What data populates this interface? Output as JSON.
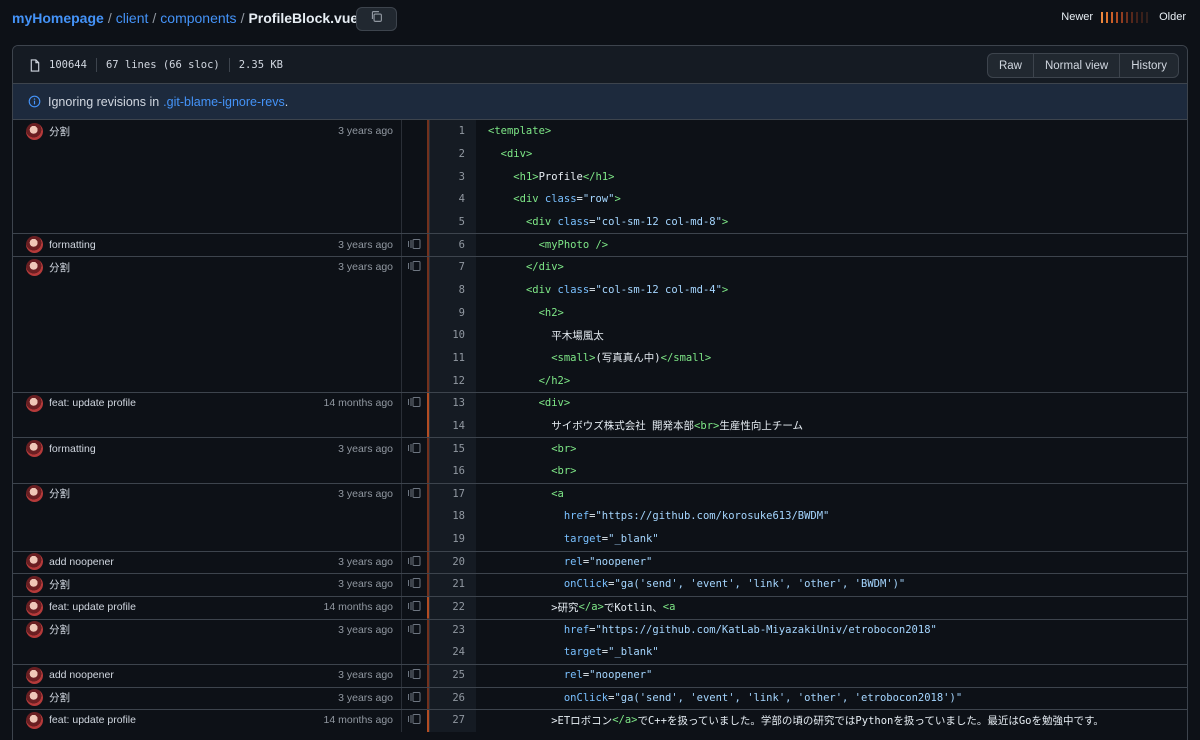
{
  "breadcrumb": {
    "repo": "myHomepage",
    "parts": [
      "client",
      "components"
    ],
    "file": "ProfileBlock.vue",
    "separator": "/"
  },
  "legend": {
    "newer": "Newer",
    "older": "Older",
    "colors": [
      "#f0883e",
      "#e0742f",
      "#cc5f28",
      "#b34d23",
      "#913d20",
      "#72311d",
      "#57281b",
      "#45221a",
      "#3a201a",
      "#32201c"
    ]
  },
  "fileinfo": {
    "mode": "100644",
    "lines": "67 lines (66 sloc)",
    "size": "2.35 KB"
  },
  "view_buttons": {
    "raw": "Raw",
    "normal": "Normal view",
    "history": "History"
  },
  "flash": {
    "text": "Ignoring revisions in",
    "link": ".git-blame-ignore-revs",
    "suffix": "."
  },
  "colors": {
    "link": "#4493f8",
    "tag": "#7ee787",
    "attr": "#79c0ff",
    "string": "#a5d6ff"
  },
  "blocks": [
    {
      "msg": "分割",
      "age": "3 years ago",
      "start": 1,
      "count": 5,
      "reblame": false,
      "heat": "#72311d"
    },
    {
      "msg": "formatting",
      "age": "3 years ago",
      "start": 6,
      "count": 1,
      "reblame": true,
      "heat": "#72311d"
    },
    {
      "msg": "分割",
      "age": "3 years ago",
      "start": 7,
      "count": 6,
      "reblame": true,
      "heat": "#72311d"
    },
    {
      "msg": "feat: update profile",
      "age": "14 months ago",
      "start": 13,
      "count": 2,
      "reblame": true,
      "heat": "#b34d23"
    },
    {
      "msg": "formatting",
      "age": "3 years ago",
      "start": 15,
      "count": 2,
      "reblame": true,
      "heat": "#72311d"
    },
    {
      "msg": "分割",
      "age": "3 years ago",
      "start": 17,
      "count": 3,
      "reblame": true,
      "heat": "#72311d"
    },
    {
      "msg": "add noopener",
      "age": "3 years ago",
      "start": 20,
      "count": 1,
      "reblame": true,
      "heat": "#72311d"
    },
    {
      "msg": "分割",
      "age": "3 years ago",
      "start": 21,
      "count": 1,
      "reblame": true,
      "heat": "#72311d"
    },
    {
      "msg": "feat: update profile",
      "age": "14 months ago",
      "start": 22,
      "count": 1,
      "reblame": true,
      "heat": "#b34d23"
    },
    {
      "msg": "分割",
      "age": "3 years ago",
      "start": 23,
      "count": 2,
      "reblame": true,
      "heat": "#72311d"
    },
    {
      "msg": "add noopener",
      "age": "3 years ago",
      "start": 25,
      "count": 1,
      "reblame": true,
      "heat": "#72311d"
    },
    {
      "msg": "分割",
      "age": "3 years ago",
      "start": 26,
      "count": 1,
      "reblame": true,
      "heat": "#72311d"
    },
    {
      "msg": "feat: update profile",
      "age": "14 months ago",
      "start": 27,
      "count": 1,
      "reblame": true,
      "heat": "#b34d23"
    }
  ],
  "lines": [
    [
      [
        "tag",
        "<template>"
      ]
    ],
    [
      [
        "",
        "  "
      ],
      [
        "tag",
        "<div>"
      ]
    ],
    [
      [
        "",
        "    "
      ],
      [
        "tag",
        "<h1>"
      ],
      [
        "",
        "Profile"
      ],
      [
        "tag",
        "</h1>"
      ]
    ],
    [
      [
        "",
        "    "
      ],
      [
        "tag",
        "<div "
      ],
      [
        "attr",
        "class"
      ],
      [
        "",
        "="
      ],
      [
        "str",
        "\"row\""
      ],
      [
        "tag",
        ">"
      ]
    ],
    [
      [
        "",
        "      "
      ],
      [
        "tag",
        "<div "
      ],
      [
        "attr",
        "class"
      ],
      [
        "",
        "="
      ],
      [
        "str",
        "\"col-sm-12 col-md-8\""
      ],
      [
        "tag",
        ">"
      ]
    ],
    [
      [
        "",
        "        "
      ],
      [
        "tag",
        "<myPhoto />"
      ]
    ],
    [
      [
        "",
        "      "
      ],
      [
        "tag",
        "</div>"
      ]
    ],
    [
      [
        "",
        "      "
      ],
      [
        "tag",
        "<div "
      ],
      [
        "attr",
        "class"
      ],
      [
        "",
        "="
      ],
      [
        "str",
        "\"col-sm-12 col-md-4\""
      ],
      [
        "tag",
        ">"
      ]
    ],
    [
      [
        "",
        "        "
      ],
      [
        "tag",
        "<h2>"
      ]
    ],
    [
      [
        "",
        "          平木場風太"
      ]
    ],
    [
      [
        "",
        "          "
      ],
      [
        "tag",
        "<small>"
      ],
      [
        "",
        "(写真真ん中)"
      ],
      [
        "tag",
        "</small>"
      ]
    ],
    [
      [
        "",
        "        "
      ],
      [
        "tag",
        "</h2>"
      ]
    ],
    [
      [
        "",
        "        "
      ],
      [
        "tag",
        "<div>"
      ]
    ],
    [
      [
        "",
        "          サイボウズ株式会社 開発本部"
      ],
      [
        "tag",
        "<br>"
      ],
      [
        "",
        "生産性向上チーム"
      ]
    ],
    [
      [
        "",
        "          "
      ],
      [
        "tag",
        "<br>"
      ]
    ],
    [
      [
        "",
        "          "
      ],
      [
        "tag",
        "<br>"
      ]
    ],
    [
      [
        "",
        "          "
      ],
      [
        "tag",
        "<a"
      ]
    ],
    [
      [
        "",
        "            "
      ],
      [
        "attr",
        "href"
      ],
      [
        "",
        "="
      ],
      [
        "str",
        "\"https://github.com/korosuke613/BWDM\""
      ]
    ],
    [
      [
        "",
        "            "
      ],
      [
        "attr",
        "target"
      ],
      [
        "",
        "="
      ],
      [
        "str",
        "\"_blank\""
      ]
    ],
    [
      [
        "",
        "            "
      ],
      [
        "attr",
        "rel"
      ],
      [
        "",
        "="
      ],
      [
        "str",
        "\"noopener\""
      ]
    ],
    [
      [
        "",
        "            "
      ],
      [
        "attr",
        "onClick"
      ],
      [
        "",
        "="
      ],
      [
        "str",
        "\"ga('send', 'event', 'link', 'other', 'BWDM')\""
      ]
    ],
    [
      [
        "",
        "          >研究"
      ],
      [
        "tag",
        "</a>"
      ],
      [
        "",
        "でKotlin、"
      ],
      [
        "tag",
        "<a"
      ]
    ],
    [
      [
        "",
        "            "
      ],
      [
        "attr",
        "href"
      ],
      [
        "",
        "="
      ],
      [
        "str",
        "\"https://github.com/KatLab-MiyazakiUniv/etrobocon2018\""
      ]
    ],
    [
      [
        "",
        "            "
      ],
      [
        "attr",
        "target"
      ],
      [
        "",
        "="
      ],
      [
        "str",
        "\"_blank\""
      ]
    ],
    [
      [
        "",
        "            "
      ],
      [
        "attr",
        "rel"
      ],
      [
        "",
        "="
      ],
      [
        "str",
        "\"noopener\""
      ]
    ],
    [
      [
        "",
        "            "
      ],
      [
        "attr",
        "onClick"
      ],
      [
        "",
        "="
      ],
      [
        "str",
        "\"ga('send', 'event', 'link', 'other', 'etrobocon2018')\""
      ]
    ],
    [
      [
        "",
        "          >ETロボコン"
      ],
      [
        "tag",
        "</a>"
      ],
      [
        "",
        "でC++を扱っていました。学部の頃の研究ではPythonを扱っていました。最近はGoを勉強中です。"
      ]
    ]
  ]
}
